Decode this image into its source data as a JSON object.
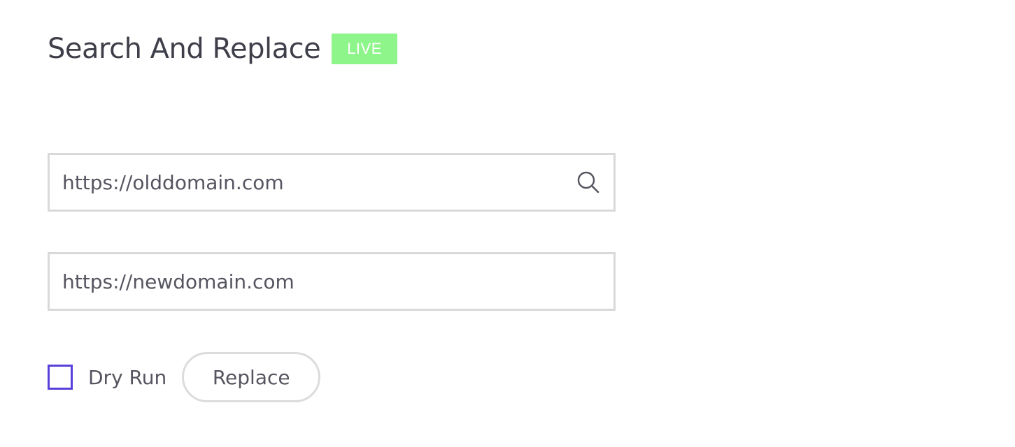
{
  "header": {
    "title": "Search And Replace",
    "badge": "LIVE"
  },
  "colors": {
    "badge_bg": "#8ef58a",
    "checkbox_border": "#5b3fd9",
    "field_border": "#d9d9d9",
    "text": "#555560"
  },
  "search": {
    "placeholder": "https://olddomain.com",
    "value": "",
    "icon": "search-icon"
  },
  "replace": {
    "placeholder": "https://newdomain.com",
    "value": ""
  },
  "options": {
    "dry_run_label": "Dry Run",
    "dry_run_checked": false
  },
  "actions": {
    "replace_label": "Replace"
  }
}
